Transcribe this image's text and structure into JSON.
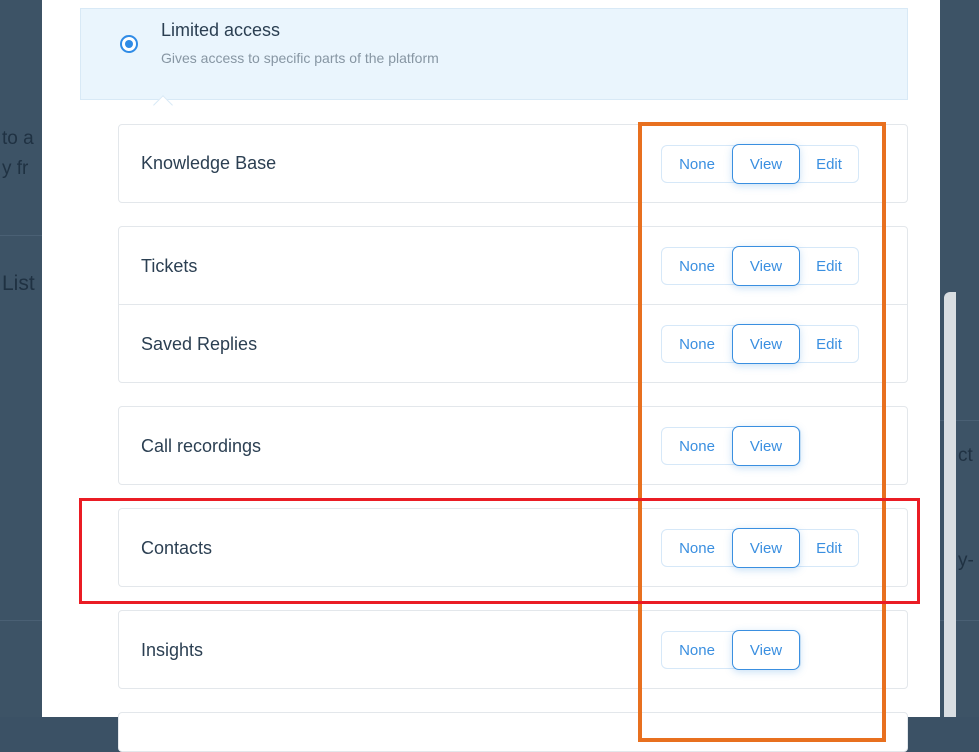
{
  "background": {
    "fragments": [
      "to a",
      "y fr",
      "List",
      "ct",
      "y-"
    ]
  },
  "access_option": {
    "title": "Limited access",
    "description": "Gives access to specific parts of the platform",
    "selected": true
  },
  "levels": {
    "none": "None",
    "view": "View",
    "edit": "Edit"
  },
  "permissions": [
    {
      "label": "Knowledge Base",
      "options": [
        "None",
        "View",
        "Edit"
      ],
      "selected": "View"
    },
    {
      "label": "Tickets",
      "options": [
        "None",
        "View",
        "Edit"
      ],
      "selected": "View"
    },
    {
      "label": "Saved Replies",
      "options": [
        "None",
        "View",
        "Edit"
      ],
      "selected": "View"
    },
    {
      "label": "Call recordings",
      "options": [
        "None",
        "View"
      ],
      "selected": "View"
    },
    {
      "label": "Contacts",
      "options": [
        "None",
        "View",
        "Edit"
      ],
      "selected": "View"
    },
    {
      "label": "Insights",
      "options": [
        "None",
        "View"
      ],
      "selected": "View"
    }
  ],
  "colors": {
    "accent": "#3a8fe0",
    "highlight_orange": "#e8701f",
    "highlight_red": "#ea1c24",
    "panel_bg": "#eaf5fd"
  }
}
